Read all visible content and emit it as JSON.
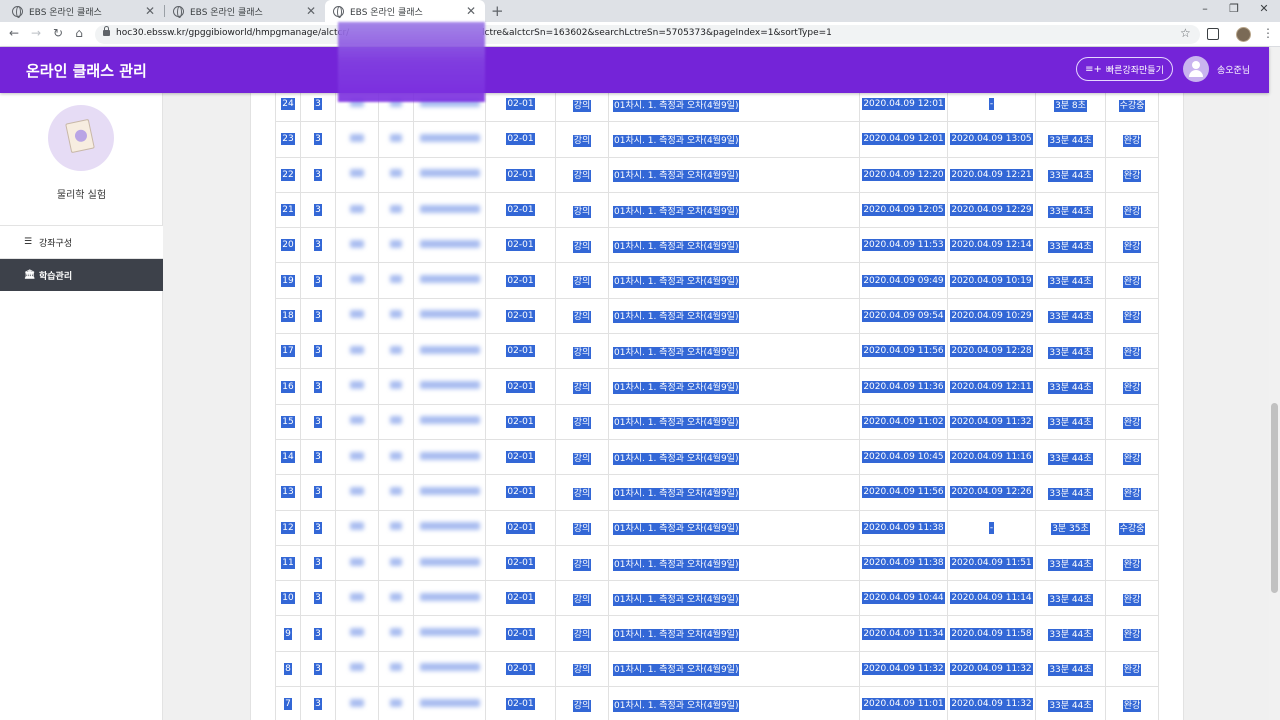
{
  "browser": {
    "tabs": [
      {
        "title": "EBS 온라인 클래스"
      },
      {
        "title": "EBS 온라인 클래스"
      },
      {
        "title": "EBS 온라인 클래스"
      }
    ],
    "url_left": "hoc30.ebssw.kr/gpggibioworld/hmpgmanage/alctcr/",
    "url_right": "lctre&alctcrSn=163602&searchLctreSn=5705373&pageIndex=1&sortType=1"
  },
  "header": {
    "title": "온라인 클래스 관리",
    "quick_button": "빠른강좌만들기",
    "username": "송오준님"
  },
  "sidebar": {
    "class_name": "물리학 실험",
    "items": [
      {
        "label": "강좌구성",
        "active": false
      },
      {
        "label": "학습관리",
        "active": true
      }
    ]
  },
  "table": {
    "rows": [
      {
        "no": "24",
        "grade": "3",
        "code": "02-01",
        "type": "강의",
        "title": "01차시. 1. 측정과 오차(4월9일)",
        "start": "2020.04.09 12:01",
        "end": "-",
        "time": "3분 8초",
        "status": "수강중"
      },
      {
        "no": "23",
        "grade": "3",
        "code": "02-01",
        "type": "강의",
        "title": "01차시. 1. 측정과 오차(4월9일)",
        "start": "2020.04.09 12:01",
        "end": "2020.04.09 13:05",
        "time": "33분 44초",
        "status": "완강"
      },
      {
        "no": "22",
        "grade": "3",
        "code": "02-01",
        "type": "강의",
        "title": "01차시. 1. 측정과 오차(4월9일)",
        "start": "2020.04.09 12:20",
        "end": "2020.04.09 12:21",
        "time": "33분 44초",
        "status": "완강"
      },
      {
        "no": "21",
        "grade": "3",
        "code": "02-01",
        "type": "강의",
        "title": "01차시. 1. 측정과 오차(4월9일)",
        "start": "2020.04.09 12:05",
        "end": "2020.04.09 12:29",
        "time": "33분 44초",
        "status": "완강"
      },
      {
        "no": "20",
        "grade": "3",
        "code": "02-01",
        "type": "강의",
        "title": "01차시. 1. 측정과 오차(4월9일)",
        "start": "2020.04.09 11:53",
        "end": "2020.04.09 12:14",
        "time": "33분 44초",
        "status": "완강"
      },
      {
        "no": "19",
        "grade": "3",
        "code": "02-01",
        "type": "강의",
        "title": "01차시. 1. 측정과 오차(4월9일)",
        "start": "2020.04.09 09:49",
        "end": "2020.04.09 10:19",
        "time": "33분 44초",
        "status": "완강"
      },
      {
        "no": "18",
        "grade": "3",
        "code": "02-01",
        "type": "강의",
        "title": "01차시. 1. 측정과 오차(4월9일)",
        "start": "2020.04.09 09:54",
        "end": "2020.04.09 10:29",
        "time": "33분 44초",
        "status": "완강"
      },
      {
        "no": "17",
        "grade": "3",
        "code": "02-01",
        "type": "강의",
        "title": "01차시. 1. 측정과 오차(4월9일)",
        "start": "2020.04.09 11:56",
        "end": "2020.04.09 12:28",
        "time": "33분 44초",
        "status": "완강"
      },
      {
        "no": "16",
        "grade": "3",
        "code": "02-01",
        "type": "강의",
        "title": "01차시. 1. 측정과 오차(4월9일)",
        "start": "2020.04.09 11:36",
        "end": "2020.04.09 12:11",
        "time": "33분 44초",
        "status": "완강"
      },
      {
        "no": "15",
        "grade": "3",
        "code": "02-01",
        "type": "강의",
        "title": "01차시. 1. 측정과 오차(4월9일)",
        "start": "2020.04.09 11:02",
        "end": "2020.04.09 11:32",
        "time": "33분 44초",
        "status": "완강"
      },
      {
        "no": "14",
        "grade": "3",
        "code": "02-01",
        "type": "강의",
        "title": "01차시. 1. 측정과 오차(4월9일)",
        "start": "2020.04.09 10:45",
        "end": "2020.04.09 11:16",
        "time": "33분 44초",
        "status": "완강"
      },
      {
        "no": "13",
        "grade": "3",
        "code": "02-01",
        "type": "강의",
        "title": "01차시. 1. 측정과 오차(4월9일)",
        "start": "2020.04.09 11:56",
        "end": "2020.04.09 12:26",
        "time": "33분 44초",
        "status": "완강"
      },
      {
        "no": "12",
        "grade": "3",
        "code": "02-01",
        "type": "강의",
        "title": "01차시. 1. 측정과 오차(4월9일)",
        "start": "2020.04.09 11:38",
        "end": "-",
        "time": "3분 35초",
        "status": "수강중"
      },
      {
        "no": "11",
        "grade": "3",
        "code": "02-01",
        "type": "강의",
        "title": "01차시. 1. 측정과 오차(4월9일)",
        "start": "2020.04.09 11:38",
        "end": "2020.04.09 11:51",
        "time": "33분 44초",
        "status": "완강"
      },
      {
        "no": "10",
        "grade": "3",
        "code": "02-01",
        "type": "강의",
        "title": "01차시. 1. 측정과 오차(4월9일)",
        "start": "2020.04.09 10:44",
        "end": "2020.04.09 11:14",
        "time": "33분 44초",
        "status": "완강"
      },
      {
        "no": "9",
        "grade": "3",
        "code": "02-01",
        "type": "강의",
        "title": "01차시. 1. 측정과 오차(4월9일)",
        "start": "2020.04.09 11:34",
        "end": "2020.04.09 11:58",
        "time": "33분 44초",
        "status": "완강"
      },
      {
        "no": "8",
        "grade": "3",
        "code": "02-01",
        "type": "강의",
        "title": "01차시. 1. 측정과 오차(4월9일)",
        "start": "2020.04.09 11:32",
        "end": "2020.04.09 11:32",
        "time": "33분 44초",
        "status": "완강"
      },
      {
        "no": "7",
        "grade": "3",
        "code": "02-01",
        "type": "강의",
        "title": "01차시. 1. 측정과 오차(4월9일)",
        "start": "2020.04.09 11:01",
        "end": "2020.04.09 11:32",
        "time": "33분 44초",
        "status": "완강"
      }
    ]
  }
}
